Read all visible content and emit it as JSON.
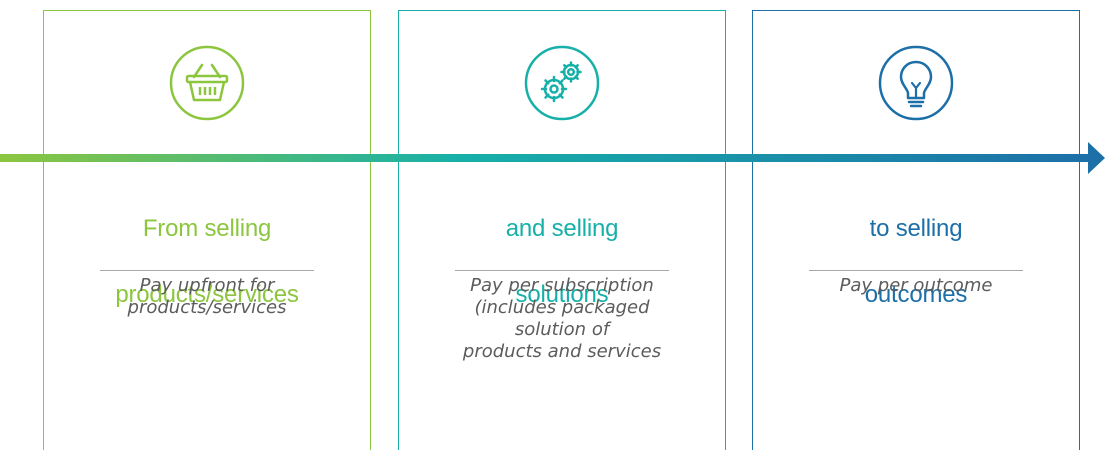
{
  "colors": {
    "green": "#8cc63f",
    "teal": "#17b0a9",
    "blue": "#1d6fa8",
    "description_text": "#5c5c5c",
    "divider": "#a8a8a8"
  },
  "panels": [
    {
      "icon": "basket-icon",
      "heading_lines": [
        "From selling",
        "products/services"
      ],
      "description_lines": [
        "Pay upfront for",
        "products/services"
      ]
    },
    {
      "icon": "gears-icon",
      "heading_lines": [
        "and selling",
        "solutions"
      ],
      "description_lines": [
        "Pay per subscription",
        "(includes packaged",
        "solution of",
        "products and services"
      ]
    },
    {
      "icon": "lightbulb-icon",
      "heading_lines": [
        "to selling",
        "outcomes"
      ],
      "description_lines": [
        "Pay per outcome"
      ]
    }
  ]
}
